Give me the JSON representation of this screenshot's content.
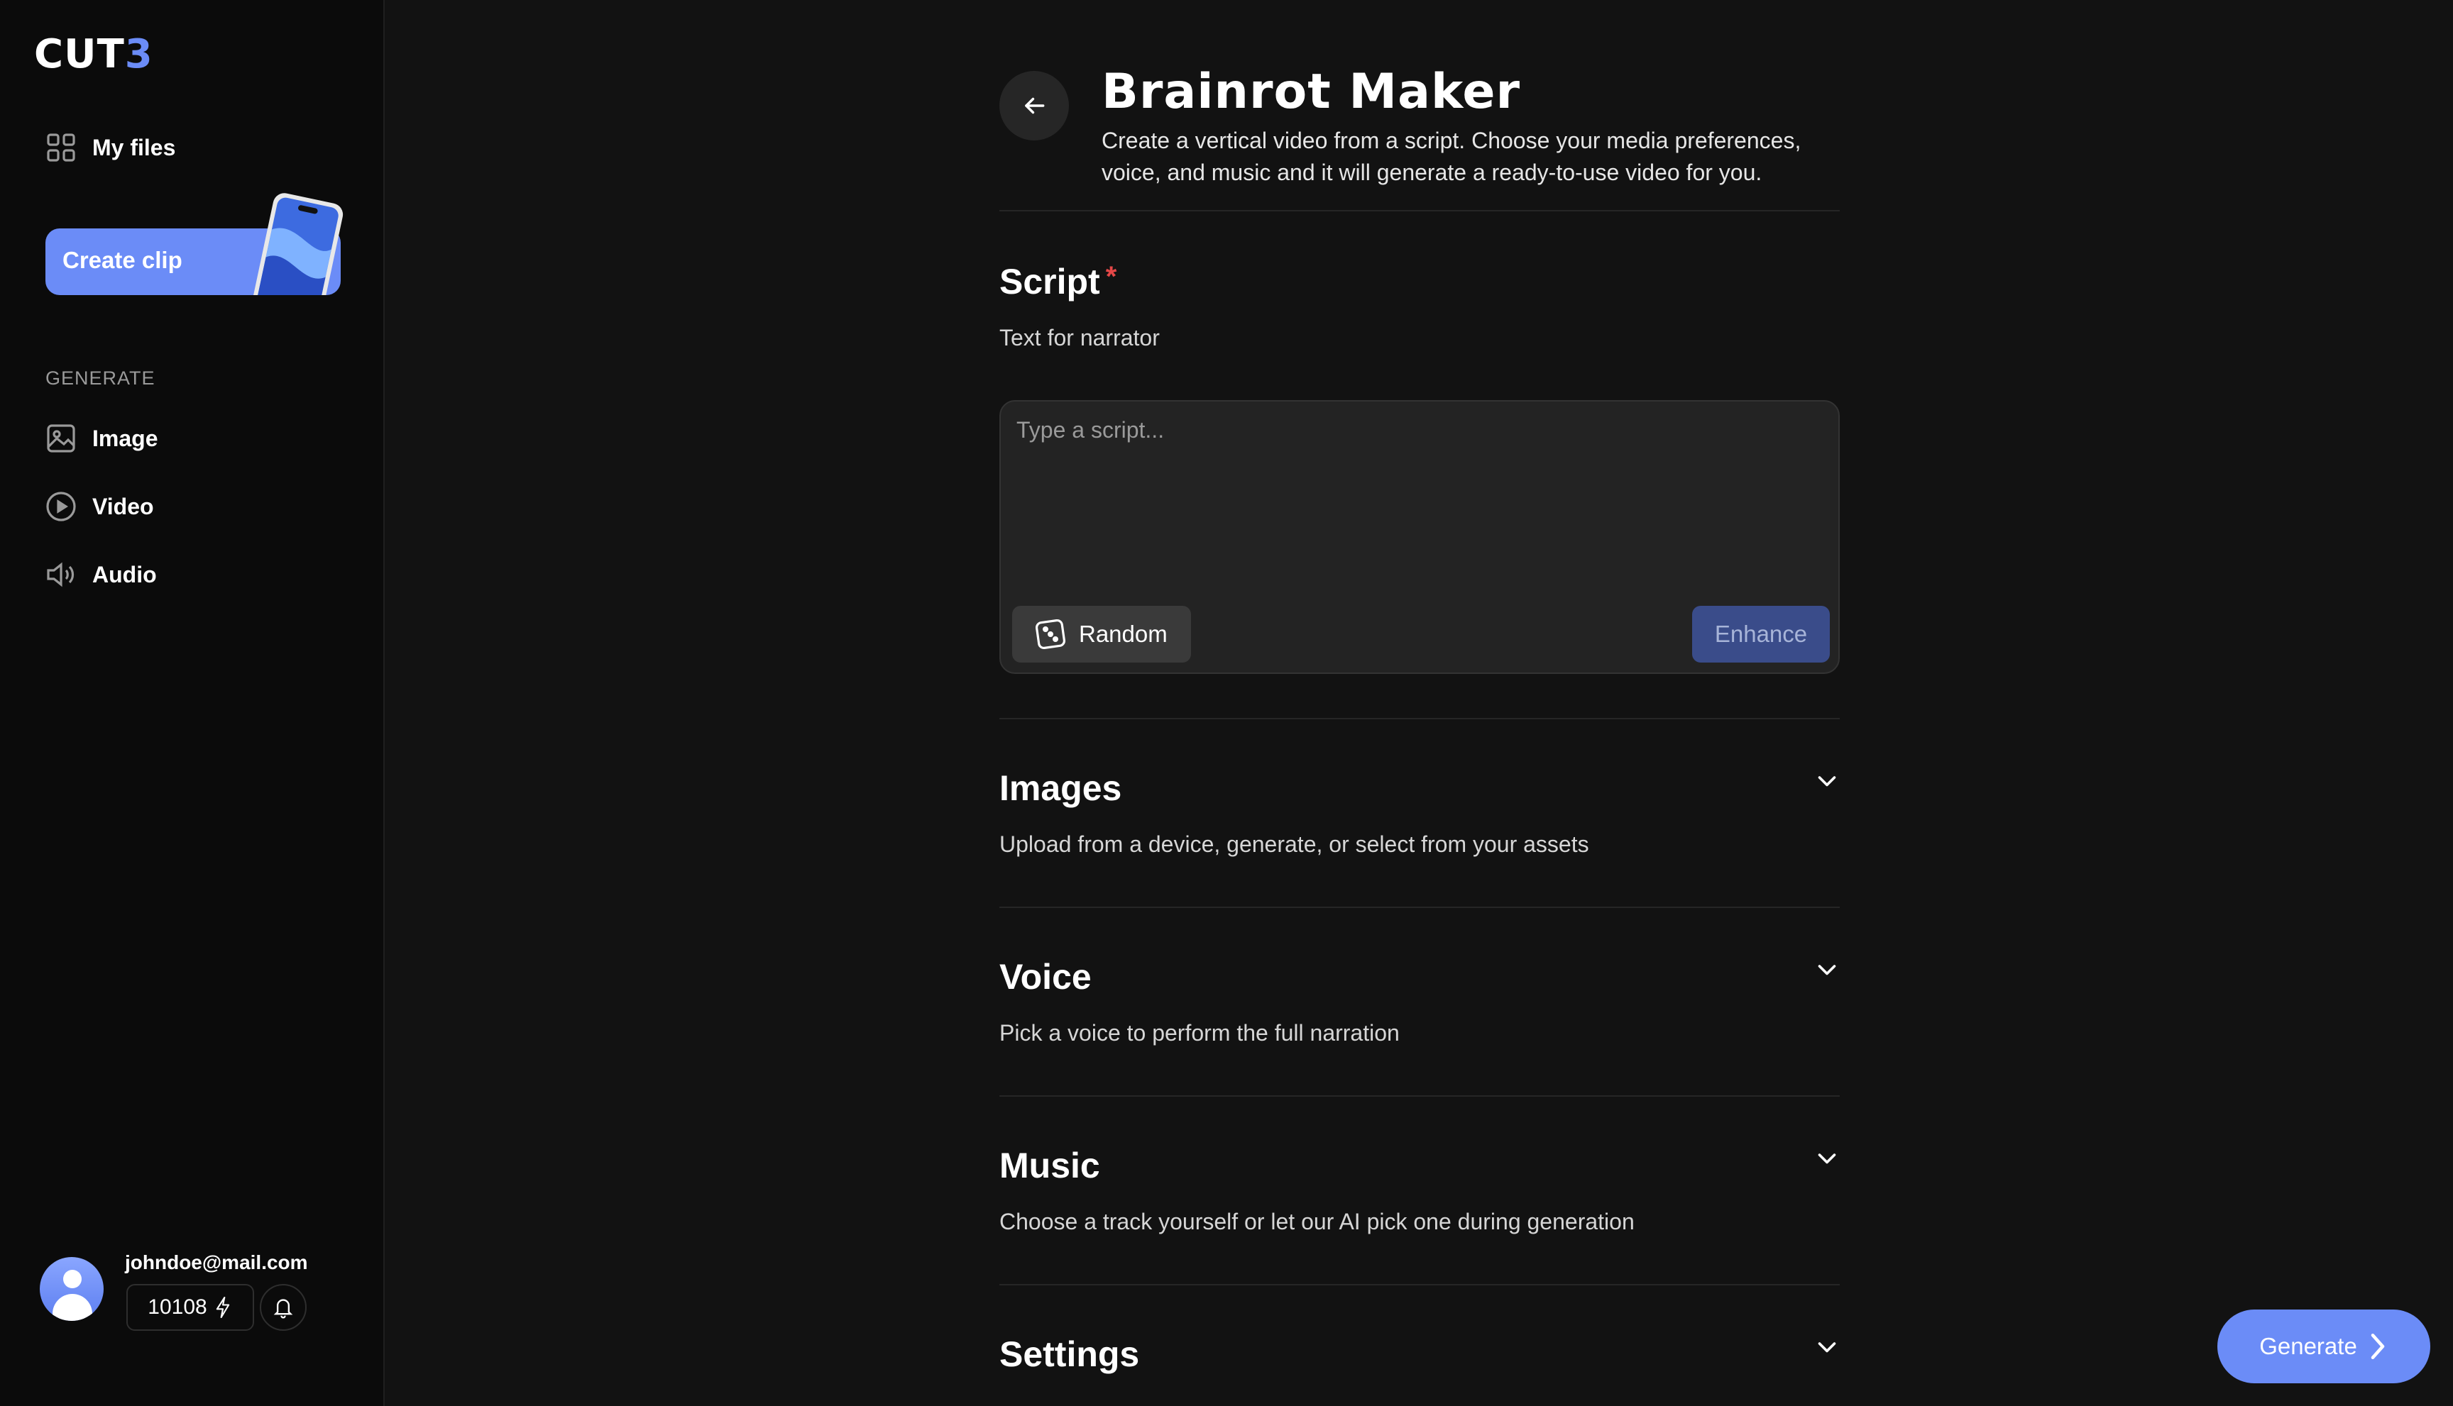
{
  "app": {
    "logo_main": "CUT",
    "logo_accent": "3"
  },
  "sidebar": {
    "my_files": "My files",
    "create_clip": "Create clip",
    "section_label": "GENERATE",
    "items": [
      {
        "label": "Image",
        "icon": "image-icon"
      },
      {
        "label": "Video",
        "icon": "play-circle-icon"
      },
      {
        "label": "Audio",
        "icon": "speaker-icon"
      }
    ],
    "user": {
      "email": "johndoe@mail.com",
      "credits": "10108"
    }
  },
  "main": {
    "title": "Brainrot Maker",
    "description": "Create a vertical video from a script. Choose your media preferences, voice, and music and it will generate a ready-to-use video for you.",
    "script": {
      "title": "Script",
      "required_mark": "*",
      "subtitle": "Text for narrator",
      "placeholder": "Type a script...",
      "random_label": "Random",
      "enhance_label": "Enhance"
    },
    "sections": [
      {
        "title": "Images",
        "subtitle": "Upload from a device, generate, or select from your assets"
      },
      {
        "title": "Voice",
        "subtitle": "Pick a voice to perform the full narration"
      },
      {
        "title": "Music",
        "subtitle": "Choose a track yourself or let our AI pick one during generation"
      },
      {
        "title": "Settings",
        "subtitle": ""
      }
    ],
    "generate_label": "Generate"
  },
  "colors": {
    "accent": "#6b8cf7",
    "background": "#121212",
    "sidebar": "#0b0b0b",
    "required": "#e54848"
  }
}
